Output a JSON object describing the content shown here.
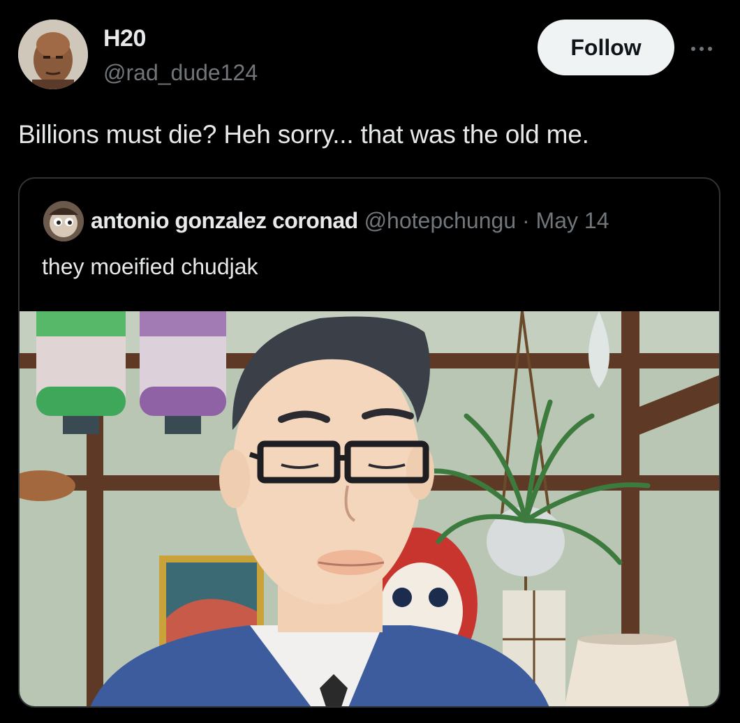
{
  "author": {
    "display_name": "H20",
    "handle": "@rad_dude124"
  },
  "follow_label": "Follow",
  "more_icon": "more-horizontal-icon",
  "tweet": {
    "text": "Billions must die? Heh sorry... that was the old me."
  },
  "quoted_tweet": {
    "display_name": "antonio gonzalez coronad",
    "handle": "@hotepchungu",
    "separator": "·",
    "date": "May 14",
    "text": "they moeified chudjak"
  },
  "colors": {
    "background": "#000000",
    "primary_text": "#e7e9ea",
    "secondary_text": "#71767b",
    "border": "#2f3336",
    "follow_bg": "#eff3f4"
  }
}
